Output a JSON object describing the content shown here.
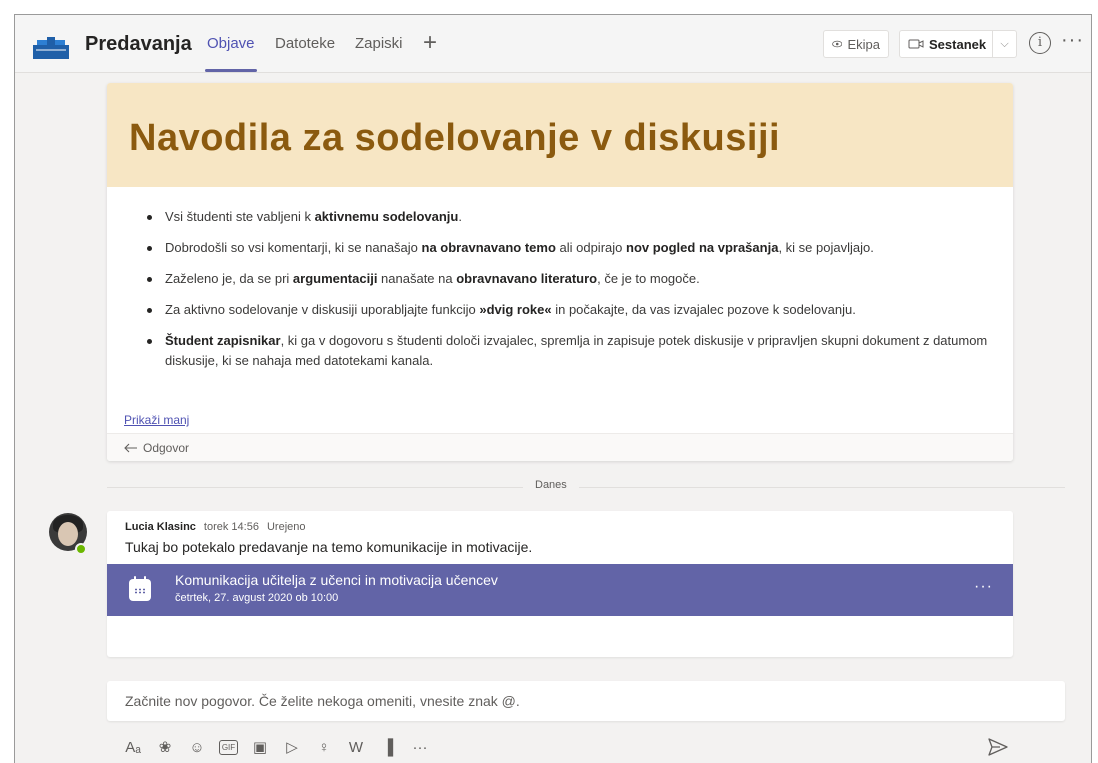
{
  "header": {
    "team_name": "Predavanja",
    "tabs": [
      {
        "label": "Objave",
        "active": true
      },
      {
        "label": "Datoteke",
        "active": false
      },
      {
        "label": "Zapiski",
        "active": false
      }
    ],
    "add_tab_symbol": "+",
    "ekipa_label": "Ekipa",
    "sestanek_label": "Sestanek",
    "info_symbol": "i",
    "more_symbol": "···"
  },
  "announcement": {
    "title": "Navodila za sodelovanje v diskusiji",
    "bullets": [
      [
        {
          "t": "Vsi študenti ste vabljeni k "
        },
        {
          "t": "aktivnemu sodelovanju",
          "b": true
        },
        {
          "t": "."
        }
      ],
      [
        {
          "t": "Dobrodošli so vsi komentarji, ki se nanašajo "
        },
        {
          "t": "na obravnavano temo",
          "b": true
        },
        {
          "t": " ali odpirajo "
        },
        {
          "t": "nov pogled na vprašanja",
          "b": true
        },
        {
          "t": ", ki se pojavljajo."
        }
      ],
      [
        {
          "t": "Zaželeno je, da se pri "
        },
        {
          "t": "argumentaciji",
          "b": true
        },
        {
          "t": " nanašate na "
        },
        {
          "t": "obravnavano literaturo",
          "b": true
        },
        {
          "t": ", če je to mogoče."
        }
      ],
      [
        {
          "t": "Za aktivno sodelovanje v diskusiji uporabljajte funkcijo "
        },
        {
          "t": "»dvig roke«",
          "b": true
        },
        {
          "t": " in počakajte, da vas izvajalec pozove k sodelovanju."
        }
      ],
      [
        {
          "t": "Študent zapisnikar",
          "b": true
        },
        {
          "t": ", ki ga v dogovoru s študenti določi izvajalec, spremlja in zapisuje potek diskusije v pripravljen skupni dokument z datumom diskusije, ki se nahaja med datotekami kanala."
        }
      ]
    ],
    "show_less": "Prikaži manj",
    "reply_label": "Odgovor"
  },
  "date_divider": "Danes",
  "message": {
    "author": "Lucia Klasinc",
    "time": "torek 14:56",
    "edited": "Urejeno",
    "text": "Tukaj bo potekalo predavanje na temo komunikacije in motivacije.",
    "meeting": {
      "title": "Komunikacija učitelja z učenci in motivacija učencev",
      "date": "četrtek, 27. avgust 2020 ob 10:00",
      "more_symbol": "···"
    }
  },
  "compose": {
    "placeholder": "Začnite nov pogovor. Če želite nekoga omeniti, vnesite znak @.",
    "tools": [
      {
        "name": "format-icon",
        "glyph": "Aₐ"
      },
      {
        "name": "attach-icon",
        "glyph": "❀"
      },
      {
        "name": "emoji-icon",
        "glyph": "☺"
      },
      {
        "name": "gif-icon",
        "glyph": "GIF"
      },
      {
        "name": "sticker-icon",
        "glyph": "▣"
      },
      {
        "name": "meet-now-icon",
        "glyph": "▷"
      },
      {
        "name": "praise-icon",
        "glyph": "♀"
      },
      {
        "name": "wiki-icon",
        "glyph": "W"
      },
      {
        "name": "stream-icon",
        "glyph": "▐"
      },
      {
        "name": "more-options-icon",
        "glyph": "···"
      }
    ]
  },
  "colors": {
    "accent": "#6264a7",
    "banner": "#f7e6c4",
    "banner_title": "#8b5a0f",
    "presence": "#6bb700"
  }
}
